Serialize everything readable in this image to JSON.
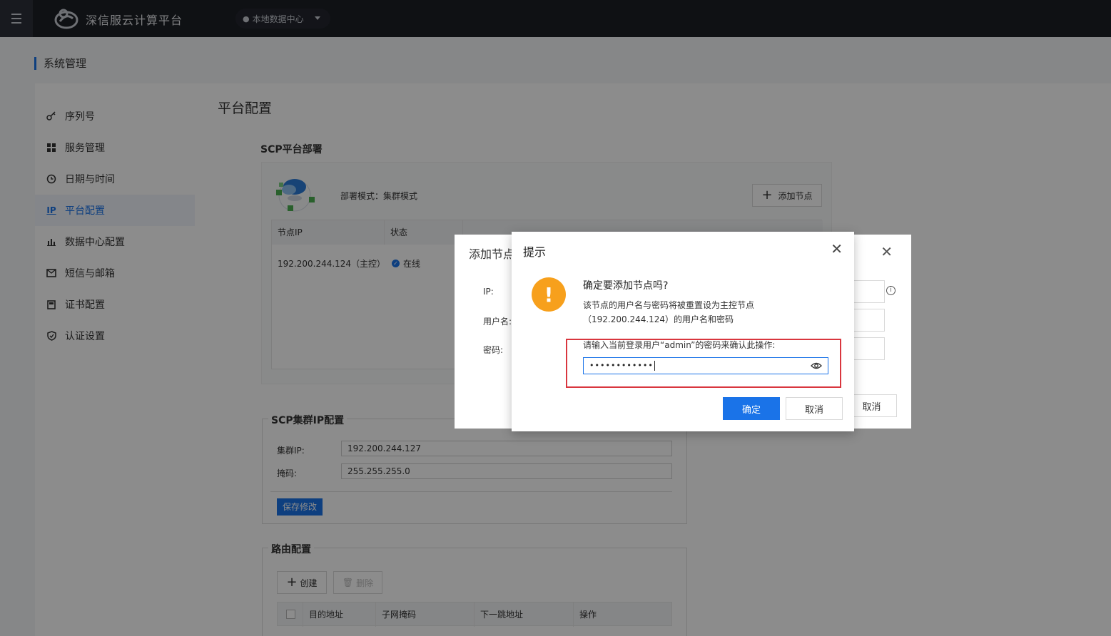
{
  "topbar": {
    "brand": "深信服云计算平台",
    "datacenter": "本地数据中心"
  },
  "page": {
    "title": "系统管理"
  },
  "sidebar": {
    "items": [
      {
        "label": "序列号",
        "icon": "key-icon"
      },
      {
        "label": "服务管理",
        "icon": "grid-icon"
      },
      {
        "label": "日期与时间",
        "icon": "clock-icon"
      },
      {
        "label": "平台配置",
        "icon": "ip-icon",
        "active": true
      },
      {
        "label": "数据中心配置",
        "icon": "bar-chart-icon"
      },
      {
        "label": "短信与邮箱",
        "icon": "mail-icon"
      },
      {
        "label": "证书配置",
        "icon": "certificate-icon"
      },
      {
        "label": "认证设置",
        "icon": "shield-icon"
      }
    ]
  },
  "main": {
    "title": "平台配置",
    "deploy": {
      "section": "SCP平台部署",
      "mode": "部署模式：集群模式",
      "add_node": "添加节点",
      "columns": [
        "节点IP",
        "状态"
      ],
      "row": {
        "ip": "192.200.244.124（主控）",
        "status": "在线"
      }
    },
    "cluster": {
      "section": "SCP集群IP配置",
      "ip_label": "集群IP:",
      "ip_value": "192.200.244.127",
      "mask_label": "掩码:",
      "mask_value": "255.255.255.0",
      "save": "保存修改"
    },
    "route": {
      "section": "路由配置",
      "create": "创建",
      "delete": "删除",
      "columns": [
        "目的地址",
        "子网掩码",
        "下一跳地址",
        "操作"
      ]
    }
  },
  "add_node_dialog": {
    "title": "添加节点",
    "ip_label": "IP:",
    "user_label": "用户名:",
    "pwd_label": "密码:",
    "cancel": "取消"
  },
  "confirm_dialog": {
    "title": "提示",
    "heading": "确定要添加节点吗?",
    "desc": "该节点的用户名与密码将被重置设为主控节点（192.200.244.124）的用户名和密码",
    "prompt": "请输入当前登录用户“admin”的密码来确认此操作:",
    "password_mask": "••••••••••••",
    "ok": "确定",
    "cancel": "取消"
  },
  "colors": {
    "accent": "#1a73e8",
    "warning": "#f7a01c",
    "highlight": "#d9363e",
    "topbar": "#1c1f26"
  }
}
